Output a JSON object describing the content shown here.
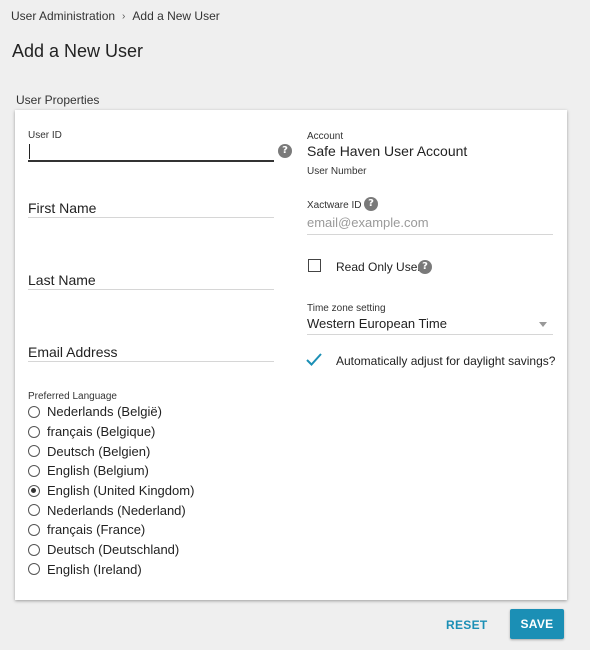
{
  "breadcrumb": {
    "parent": "User Administration",
    "separator": "›",
    "current": "Add a New User"
  },
  "page_title": "Add a New User",
  "section_title": "User Properties",
  "left": {
    "user_id": {
      "label": "User ID",
      "value": ""
    },
    "first_name": {
      "label": "First Name",
      "value": ""
    },
    "last_name": {
      "label": "Last Name",
      "value": ""
    },
    "email": {
      "label": "Email Address",
      "value": ""
    },
    "language": {
      "label": "Preferred Language",
      "selected": "English (United Kingdom)",
      "options": [
        "Nederlands (België)",
        "français (Belgique)",
        "Deutsch (Belgien)",
        "English (Belgium)",
        "English (United Kingdom)",
        "Nederlands (Nederland)",
        "français (France)",
        "Deutsch (Deutschland)",
        "English (Ireland)"
      ]
    }
  },
  "right": {
    "account": {
      "label": "Account",
      "value": "Safe Haven User Account"
    },
    "user_number": {
      "label": "User Number"
    },
    "xactware_id": {
      "label": "Xactware ID",
      "placeholder": "email@example.com"
    },
    "read_only": {
      "label": "Read Only User",
      "checked": false
    },
    "time_zone": {
      "label": "Time zone setting",
      "value": "Western European Time"
    },
    "daylight": {
      "label": "Automatically adjust for daylight savings?",
      "checked": true
    }
  },
  "help_icon_glyph": "?",
  "actions": {
    "reset_label": "RESET",
    "save_label": "SAVE"
  },
  "colors": {
    "accent": "#1b8fb5",
    "background": "#efefef",
    "card": "#ffffff"
  },
  "icons": {
    "help": "help-icon",
    "check": "check-icon",
    "dropdown": "chevron-down-icon"
  }
}
